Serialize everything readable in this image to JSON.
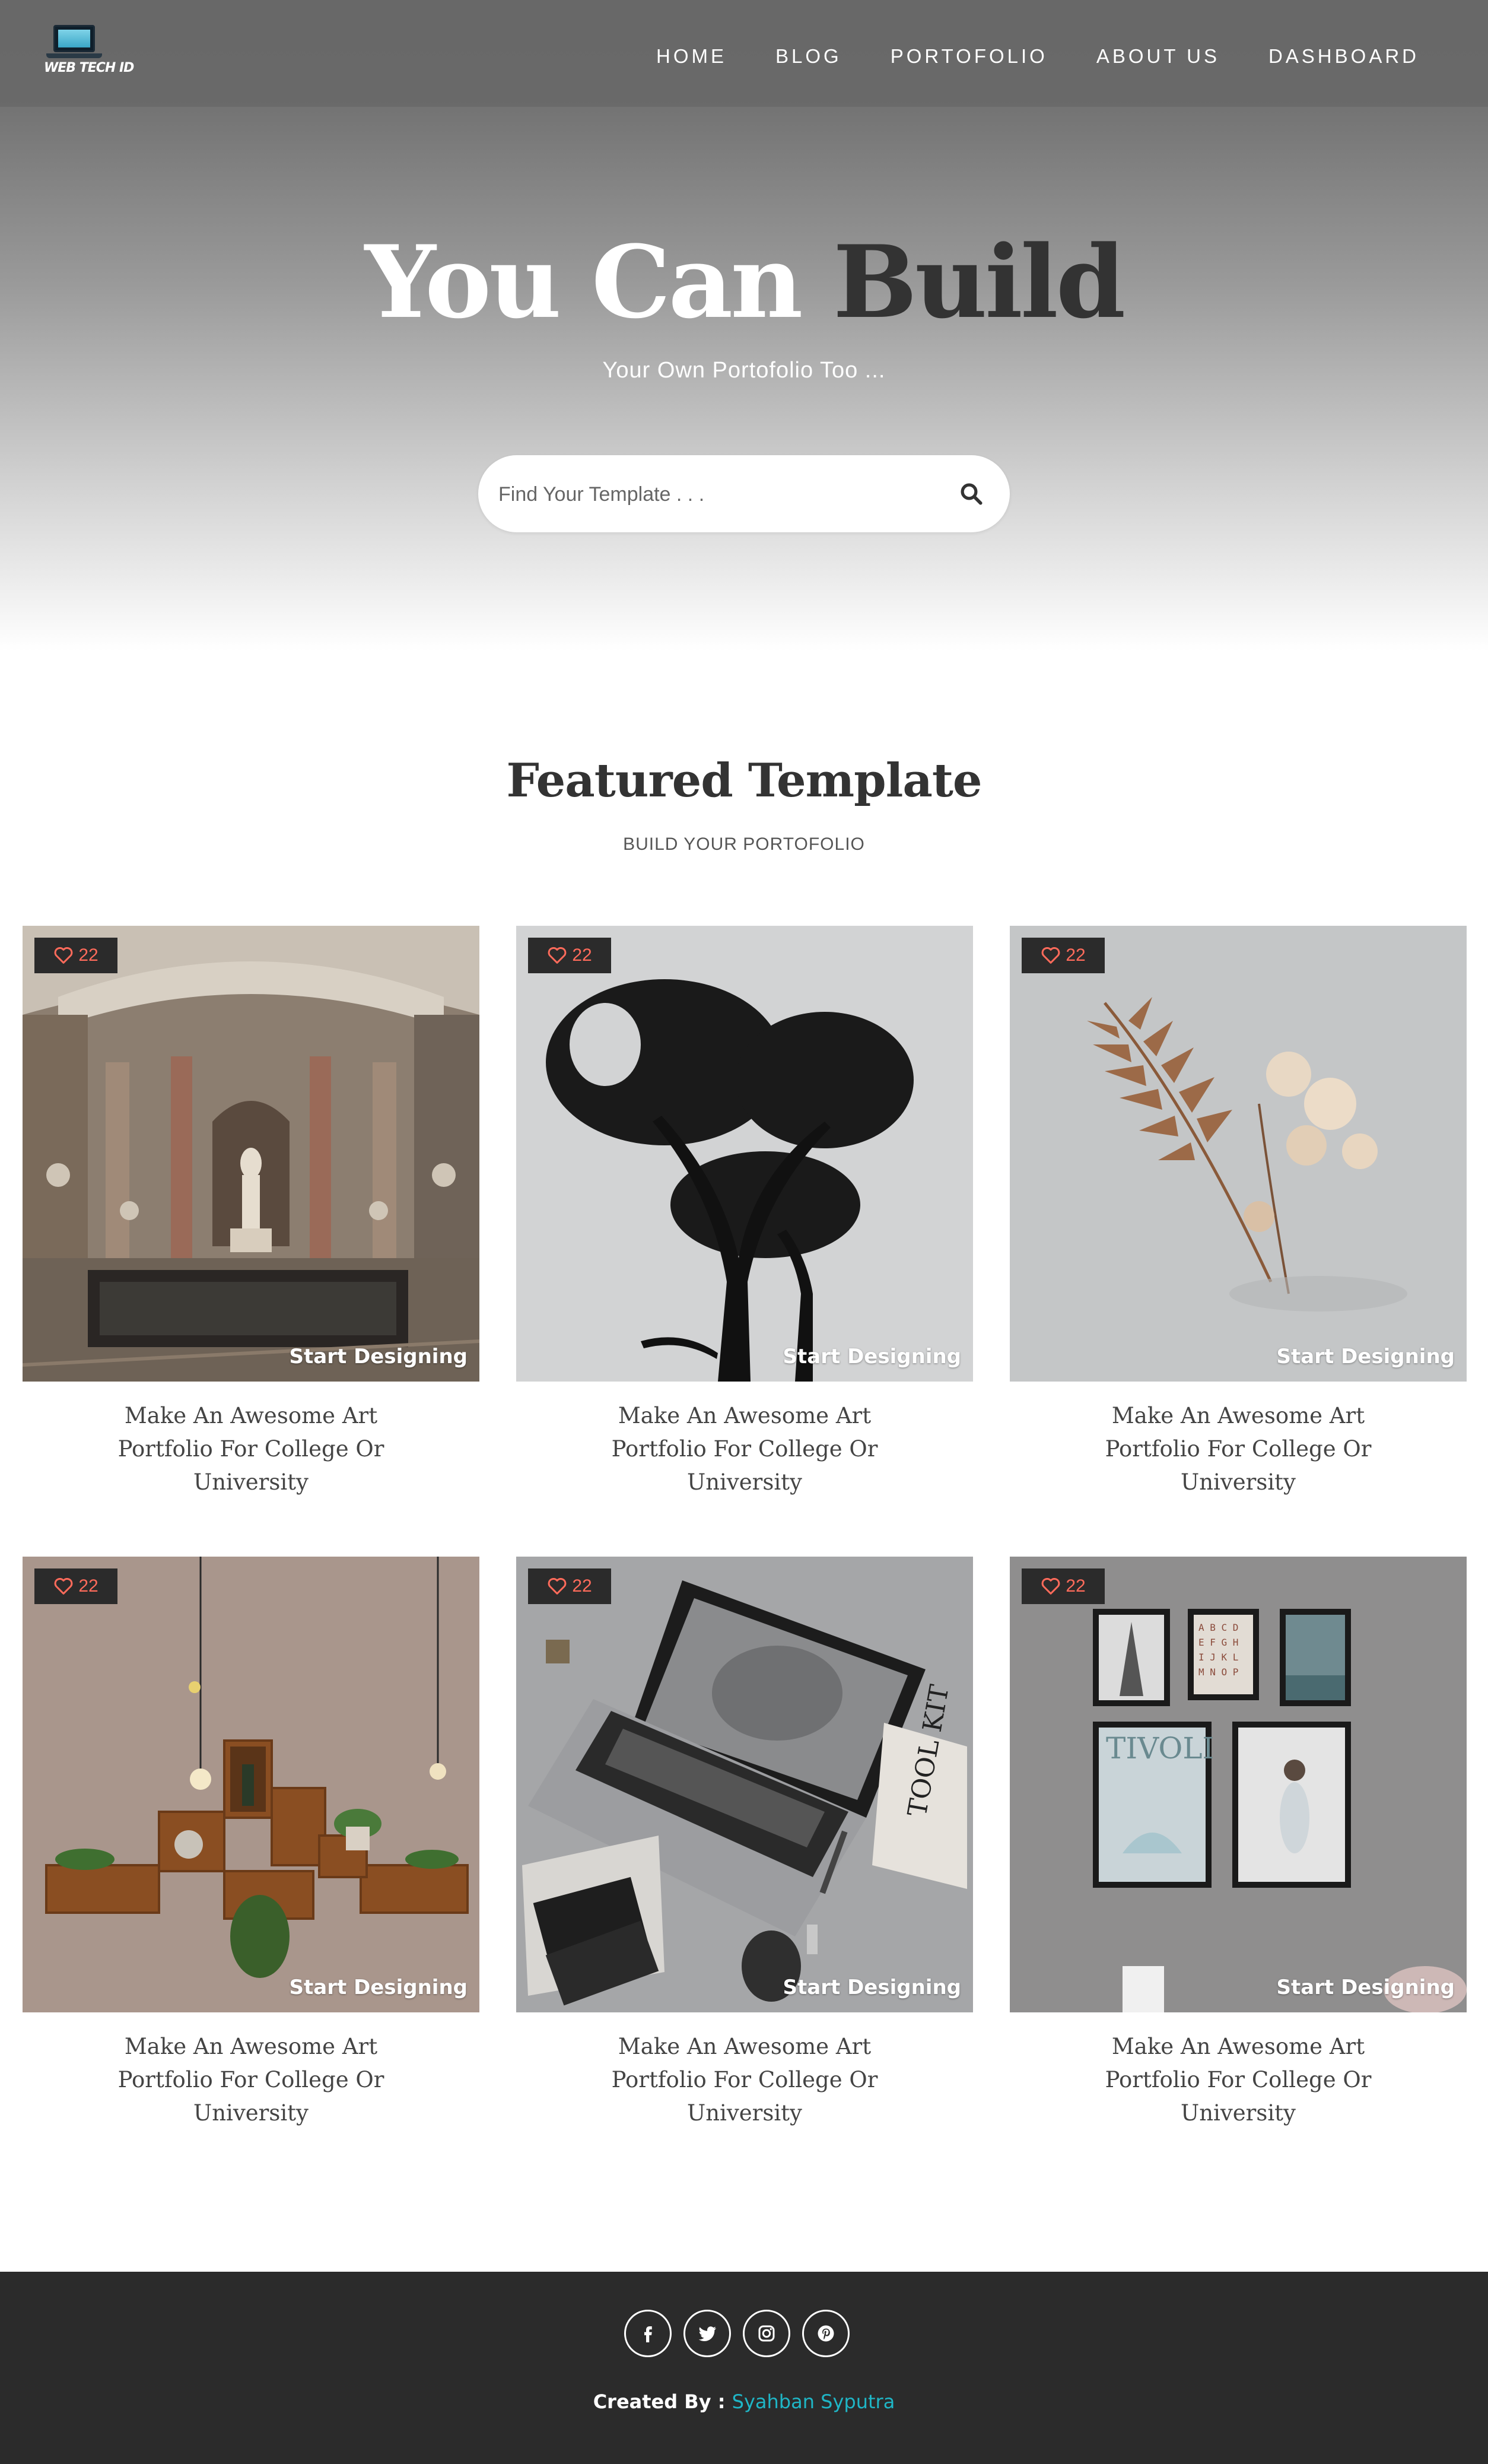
{
  "brand": {
    "logo_text": "WEB TECH ID"
  },
  "nav": {
    "items": [
      {
        "label": "HOME"
      },
      {
        "label": "BLOG"
      },
      {
        "label": "PORTOFOLIO"
      },
      {
        "label": "ABOUT US"
      },
      {
        "label": "DASHBOARD"
      }
    ]
  },
  "hero": {
    "title_light": "You Can ",
    "title_dark": "Build",
    "subtitle": "Your Own Portofolio Too ...",
    "search_placeholder": "Find Your Template . . ."
  },
  "featured": {
    "title": "Featured Template",
    "subtitle": "BUILD YOUR PORTOFOLIO",
    "cards": [
      {
        "likes": "22",
        "cta": "Start Designing",
        "caption_1": "Make An Awesome Art",
        "caption_2": "Portfolio For College Or",
        "caption_3": "University",
        "image": "museum-hall"
      },
      {
        "likes": "22",
        "cta": "Start Designing",
        "caption_1": "Make An Awesome Art",
        "caption_2": "Portfolio For College Or",
        "caption_3": "University",
        "image": "tree-silhouette"
      },
      {
        "likes": "22",
        "cta": "Start Designing",
        "caption_1": "Make An Awesome Art",
        "caption_2": "Portfolio For College Or",
        "caption_3": "University",
        "image": "dried-fern"
      },
      {
        "likes": "22",
        "cta": "Start Designing",
        "caption_1": "Make An Awesome Art",
        "caption_2": "Portfolio For College Or",
        "caption_3": "University",
        "image": "wooden-shelves"
      },
      {
        "likes": "22",
        "cta": "Start Designing",
        "caption_1": "Make An Awesome Art",
        "caption_2": "Portfolio For College Or",
        "caption_3": "University",
        "image": "laptop-desk"
      },
      {
        "likes": "22",
        "cta": "Start Designing",
        "caption_1": "Make An Awesome Art",
        "caption_2": "Portfolio For College Or",
        "caption_3": "University",
        "image": "framed-posters"
      }
    ]
  },
  "footer": {
    "socials": [
      "facebook-icon",
      "twitter-icon",
      "instagram-icon",
      "pinterest-icon"
    ],
    "credit_label": "Created By :",
    "credit_name": "Syahban Syputra",
    "credit_color": "#1fb6c6"
  },
  "colors": {
    "accent_like": "#ff6b5b",
    "footer_bg": "#2b2b2b",
    "heading": "#333333"
  }
}
